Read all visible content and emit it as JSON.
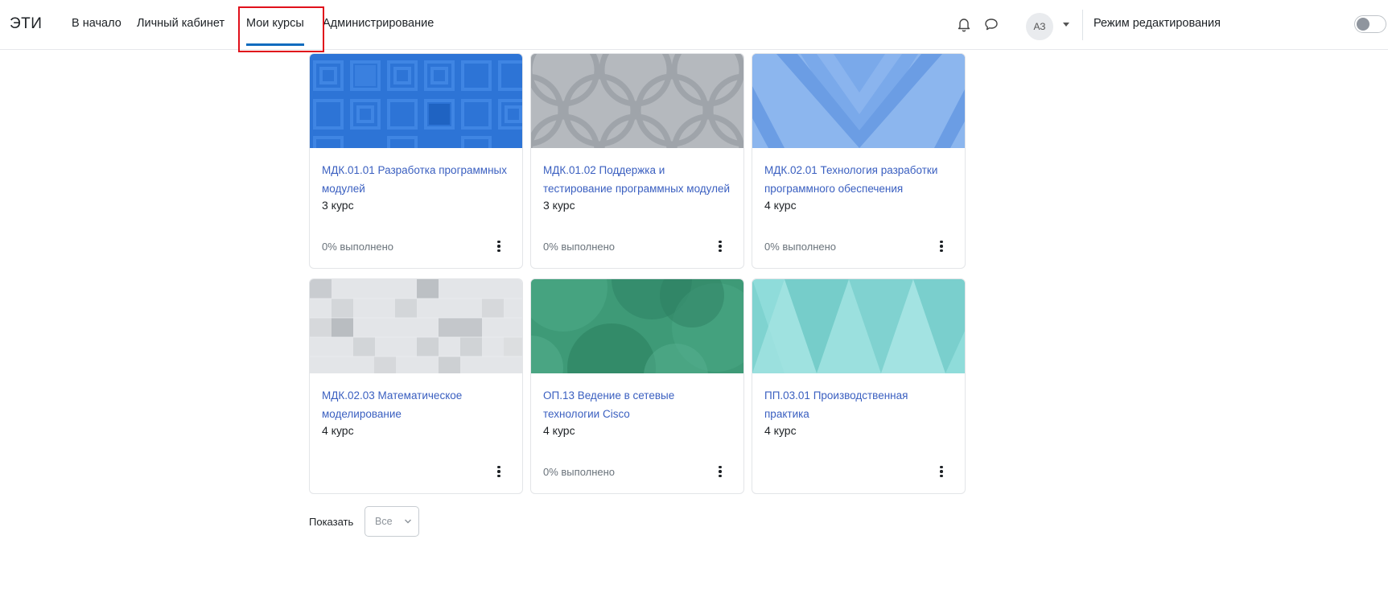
{
  "navbar": {
    "brand": "ЭТИ",
    "items": [
      {
        "label": "В начало"
      },
      {
        "label": "Личный кабинет"
      },
      {
        "label": "Мои курсы"
      },
      {
        "label": "Администрирование"
      }
    ],
    "active_item": "Мои курсы",
    "user_initials": "АЗ",
    "edit_mode_label": "Режим редактирования",
    "edit_mode_on": false,
    "icons": [
      "bell-icon",
      "chat-icon",
      "chevron-down-icon"
    ]
  },
  "courses": [
    {
      "name": "МДК.01.01 Разработка программных модулей",
      "category": "3 курс",
      "progress": "0% выполнено"
    },
    {
      "name": "МДК.01.02 Поддержка и тестирование программных модулей",
      "category": "3 курс",
      "progress": "0% выполнено"
    },
    {
      "name": "МДК.02.01 Технология разработки программного обеспечения",
      "category": "4 курс",
      "progress": "0% выполнено"
    },
    {
      "name": "МДК.02.03 Математическое моделирование",
      "category": "4 курс",
      "progress": ""
    },
    {
      "name": "ОП.13 Ведение в сетевые технологии Cisco",
      "category": "4 курс",
      "progress": "0% выполнено"
    },
    {
      "name": "ПП.03.01 Производственная практика",
      "category": "4 курс",
      "progress": ""
    }
  ],
  "colors": {
    "accent": "#0f6cbf",
    "link": "#3a5fc0",
    "highlight": "#e0101b"
  },
  "footer": {
    "show_label": "Показать",
    "show_value": "Все"
  }
}
